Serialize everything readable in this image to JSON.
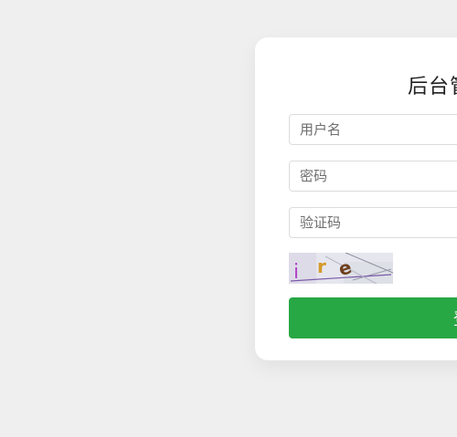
{
  "login": {
    "title": "后台管理系统",
    "username_placeholder": "用户名",
    "password_placeholder": "密码",
    "captcha_placeholder": "验证码",
    "captcha_text": "ire",
    "submit_label": "登录"
  },
  "colors": {
    "background": "#efefef",
    "card": "#ffffff",
    "primary_button": "#28a745"
  }
}
